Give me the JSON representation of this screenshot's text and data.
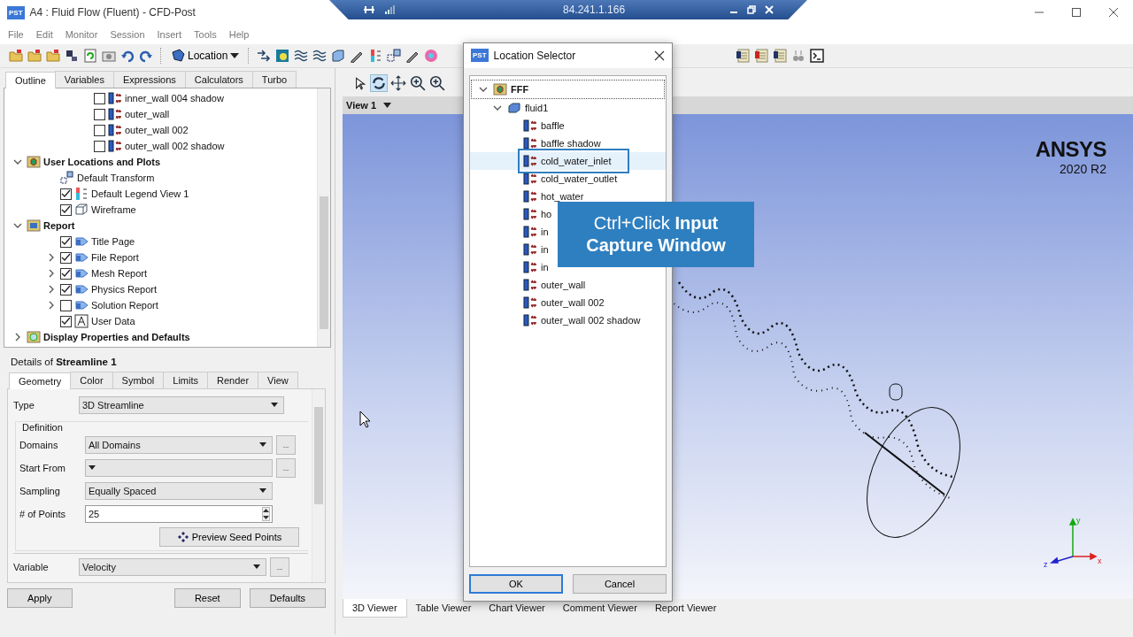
{
  "window": {
    "badge": "PST",
    "title": "A4 : Fluid Flow (Fluent) - CFD-Post"
  },
  "remote_bar": {
    "address": "84.241.1.166"
  },
  "menu": [
    "File",
    "Edit",
    "Monitor",
    "Session",
    "Insert",
    "Tools",
    "Help"
  ],
  "toolbar": {
    "location_button": "Location"
  },
  "outline": {
    "tabs": [
      {
        "label": "Outline",
        "selected": true
      },
      {
        "label": "Variables",
        "selected": false
      },
      {
        "label": "Expressions",
        "selected": false
      },
      {
        "label": "Calculators",
        "selected": false
      },
      {
        "label": "Turbo",
        "selected": false
      }
    ],
    "tree": [
      {
        "children": [
          {
            "children": [
              {
                "label": "inner_wall 004 shadow",
                "kind": "boundary",
                "checked": false
              },
              {
                "label": "outer_wall",
                "kind": "boundary",
                "checked": false
              },
              {
                "label": "outer_wall 002",
                "kind": "boundary",
                "checked": false
              },
              {
                "label": "outer_wall 002 shadow",
                "kind": "boundary",
                "checked": false
              }
            ]
          }
        ]
      },
      {
        "label": "User Locations and Plots",
        "kind": "locations",
        "expanded": true,
        "children": [
          {
            "label": "Default Transform",
            "kind": "transform"
          },
          {
            "label": "Default Legend View 1",
            "kind": "legend",
            "checked": true
          },
          {
            "label": "Wireframe",
            "kind": "wireframe",
            "checked": true
          }
        ]
      },
      {
        "label": "Report",
        "kind": "report-folder",
        "expanded": true,
        "children": [
          {
            "label": "Title Page",
            "kind": "report",
            "checked": true
          },
          {
            "label": "File Report",
            "kind": "report",
            "checked": true,
            "expanded": false
          },
          {
            "label": "Mesh Report",
            "kind": "report",
            "checked": true,
            "expanded": false
          },
          {
            "label": "Physics Report",
            "kind": "report",
            "checked": true,
            "expanded": false
          },
          {
            "label": "Solution Report",
            "kind": "report",
            "checked": false,
            "expanded": false
          },
          {
            "label": "User Data",
            "kind": "userdata",
            "checked": true
          }
        ]
      },
      {
        "label": "Display Properties and Defaults",
        "kind": "display",
        "expanded": false
      }
    ]
  },
  "details": {
    "title": "Details of **Streamline 1**",
    "tabs": [
      {
        "label": "Geometry",
        "selected": true
      },
      {
        "label": "Color",
        "selected": false
      },
      {
        "label": "Symbol",
        "selected": false
      },
      {
        "label": "Limits",
        "selected": false
      },
      {
        "label": "Render",
        "selected": false
      },
      {
        "label": "View",
        "selected": false
      }
    ],
    "type_field": {
      "label": "Type",
      "value": "3D Streamline"
    },
    "definition": {
      "label": "Definition",
      "fields": [
        {
          "label": "Domains",
          "kind": "dropdown",
          "value": "All Domains",
          "more": "..."
        },
        {
          "label": "Start From",
          "kind": "dropdown",
          "more": "..."
        },
        {
          "label": "Sampling",
          "kind": "dropdown",
          "value": "Equally Spaced"
        },
        {
          "label": "# of Points",
          "kind": "spin",
          "value": "25"
        }
      ],
      "button": "Preview Seed Points"
    },
    "variable_field": {
      "label": "Variable",
      "value": "Velocity",
      "more": "..."
    },
    "buttons": [
      "Apply",
      "Reset",
      "Defaults"
    ]
  },
  "viewer": {
    "view_label": "View 1",
    "logo": {
      "name": "ANSYS",
      "version": "2020 R2"
    },
    "axis_labels": [
      "y",
      "z",
      "x"
    ],
    "tabs": [
      {
        "label": "3D Viewer",
        "selected": true
      },
      {
        "label": "Table Viewer",
        "selected": false
      },
      {
        "label": "Chart Viewer",
        "selected": false
      },
      {
        "label": "Comment Viewer",
        "selected": false
      },
      {
        "label": "Report Viewer",
        "selected": false
      }
    ]
  },
  "location_selector": {
    "badge": "PST",
    "title": "Location Selector",
    "tree": [
      {
        "label": "FFF",
        "kind": "domain-set",
        "expanded": true,
        "children": [
          {
            "label": "fluid1",
            "kind": "domain",
            "expanded": true,
            "children": [
              {
                "label": "baffle",
                "kind": "boundary",
                "selected": false
              },
              {
                "label": "baffle shadow",
                "kind": "boundary",
                "selected": false
              },
              {
                "label": "cold_water_inlet",
                "kind": "boundary",
                "selected": true
              },
              {
                "label": "cold_water_outlet",
                "kind": "boundary",
                "selected": false
              },
              {
                "label": "hot_water",
                "kind": "boundary",
                "selected": false
              },
              {
                "label": "ho",
                "kind": "boundary",
                "selected": false
              },
              {
                "label": "in",
                "kind": "boundary",
                "selected": false
              },
              {
                "label": "in",
                "kind": "boundary",
                "selected": false
              },
              {
                "label": "in",
                "kind": "boundary",
                "selected": false
              },
              {
                "label": "outer_wall",
                "kind": "boundary",
                "selected": false
              },
              {
                "label": "outer_wall 002",
                "kind": "boundary",
                "selected": false
              },
              {
                "label": "outer_wall 002 shadow",
                "kind": "boundary",
                "selected": false
              }
            ]
          }
        ]
      }
    ],
    "buttons": [
      "OK",
      "Cancel"
    ]
  },
  "callout": {
    "text": "Ctrl+Click **Input Capture Window**"
  }
}
